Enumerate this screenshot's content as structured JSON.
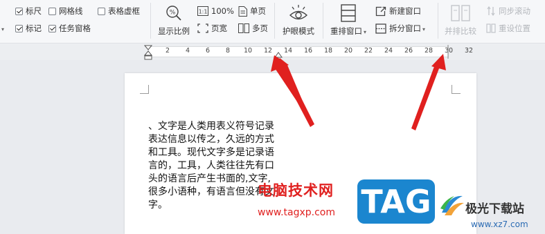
{
  "ribbon": {
    "checkboxes": [
      {
        "label": "标尺",
        "checked": true
      },
      {
        "label": "网格线",
        "checked": false
      },
      {
        "label": "表格虚框",
        "checked": false
      },
      {
        "label": "标记",
        "checked": true
      },
      {
        "label": "任务窗格",
        "checked": true
      }
    ],
    "display_ratio": "显示比例",
    "zoom_100": "100%",
    "single_page": "单页",
    "page_width": "页宽",
    "multi_page": "多页",
    "eye_protection": "护眼模式",
    "arrange_windows": "重排窗口",
    "new_window": "新建窗口",
    "split_window": "拆分窗口",
    "side_by_side": "并排比较",
    "sync_scroll": "同步滚动",
    "reset_position": "重设位置",
    "icon_label_1to1": "1:1"
  },
  "ruler": {
    "ticks": [
      "2",
      "4",
      "6",
      "8",
      "10",
      "12",
      "14",
      "16",
      "18",
      "20",
      "22",
      "24",
      "26",
      "28",
      "30",
      "32"
    ]
  },
  "document": {
    "lines": [
      "、文字是人类用表义符号记录",
      "表达信息以传之，久远的方式",
      "和工具。现代文字多是记录语",
      "言的，工具，人类往往先有口",
      "头的语言后产生书面的,文字,",
      "很多小语种，有语言但没有文",
      "字。"
    ]
  },
  "watermarks": {
    "site_name": "电脑技术网",
    "site_url": "www.tagxp.com",
    "tag": "TAG",
    "jg_name": "极光下载站",
    "jg_url": "www.xz7.com"
  },
  "colors": {
    "accent_red": "#e0201f",
    "tag_blue": "#1b86cf"
  }
}
